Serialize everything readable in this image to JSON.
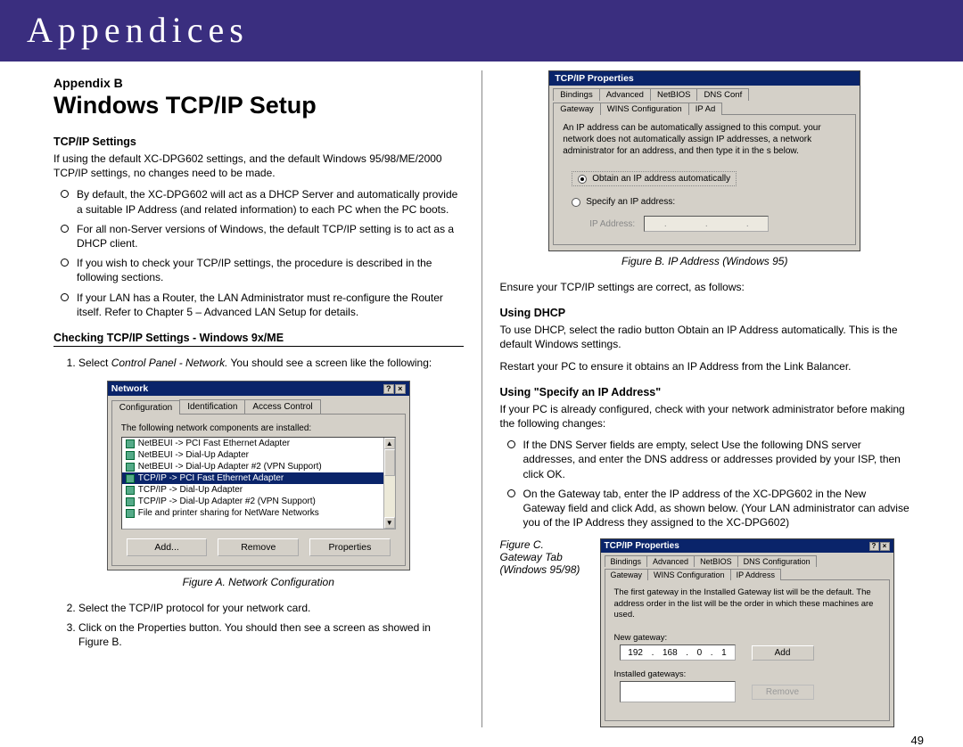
{
  "banner": "Appendices",
  "appendix_label": "Appendix B",
  "title": "Windows TCP/IP Setup",
  "left": {
    "s1_title": "TCP/IP Settings",
    "s1_intro": "If using the default XC-DPG602 settings, and the default Windows 95/98/ME/2000 TCP/IP settings, no changes need to be made.",
    "s1_bullets": [
      "By default, the XC-DPG602 will act as a DHCP Server and automatically provide a suitable IP Address (and related information) to each PC when the PC boots.",
      "For all non-Server versions of Windows, the default TCP/IP setting is to act as a DHCP client.",
      "If you wish to check your TCP/IP settings, the procedure is described in the following sections.",
      "If your LAN has a Router, the LAN Administrator must re-configure the Router itself. Refer to Chapter 5 – Advanced LAN Setup for details."
    ],
    "s2_title": "Checking TCP/IP Settings - Windows 9x/ME",
    "step1_pre": "Select ",
    "step1_em": "Control Panel - Network.",
    "step1_post": " You should see a screen like the following:",
    "figA": {
      "title": "Network",
      "tabs": [
        "Configuration",
        "Identification",
        "Access Control"
      ],
      "label": "The following network components are installed:",
      "rows": [
        "NetBEUI -> PCI Fast Ethernet Adapter",
        "NetBEUI -> Dial-Up Adapter",
        "NetBEUI -> Dial-Up Adapter #2 (VPN Support)",
        "TCP/IP -> PCI Fast Ethernet Adapter",
        "TCP/IP -> Dial-Up Adapter",
        "TCP/IP -> Dial-Up Adapter #2 (VPN Support)",
        "File and printer sharing for NetWare Networks"
      ],
      "selected_index": 3,
      "buttons": [
        "Add...",
        "Remove",
        "Properties"
      ]
    },
    "figA_caption": "Figure A. Network Configuration",
    "step2": "Select the TCP/IP protocol for your network card.",
    "step3": "Click on the Properties button. You should then see a screen as showed in Figure B."
  },
  "right": {
    "figB": {
      "title": "TCP/IP Properties",
      "tabs_row1": [
        "Bindings",
        "Advanced",
        "NetBIOS",
        "DNS Conf"
      ],
      "tabs_row2": [
        "Gateway",
        "WINS Configuration",
        "IP Ad"
      ],
      "desc": "An IP address can be automatically assigned to this comput. your network does not automatically assign IP addresses, a network administrator for an address, and then type it in the s below.",
      "radio1": "Obtain an IP address automatically",
      "radio2": "Specify an IP address:",
      "ip_label": "IP Address:"
    },
    "figB_caption": "Figure B. IP Address (Windows 95)",
    "ensure": "Ensure your TCP/IP settings are correct, as follows:",
    "dhcp_title": "Using DHCP",
    "dhcp_p1": "To use DHCP, select the radio button Obtain an IP Address automatically. This is the default Windows settings.",
    "dhcp_p2": "Restart your PC to ensure it obtains an IP Address from the Link Balancer.",
    "spec_title": "Using \"Specify an IP Address\"",
    "spec_intro": "If your PC is already configured, check with your network administrator before making the following changes:",
    "spec_bullets": [
      "If the DNS Server fields are empty, select Use the following DNS server addresses, and enter the DNS address or addresses provided by your ISP, then click OK.",
      "On the Gateway tab, enter the IP address of the XC-DPG602 in the New Gateway field and click Add, as shown below. (Your LAN administrator can advise you of the IP Address they assigned to the XC-DPG602)"
    ],
    "figC_side": "Figure C.\nGateway Tab\n(Windows 95/98)",
    "figC": {
      "title": "TCP/IP Properties",
      "tabs_row1": [
        "Bindings",
        "Advanced",
        "NetBIOS",
        "DNS Configuration"
      ],
      "tabs_row2": [
        "Gateway",
        "WINS Configuration",
        "IP Address"
      ],
      "desc": "The first gateway in the Installed Gateway list will be the default. The address order in the list will be the order in which these machines are used.",
      "new_label": "New gateway:",
      "ip_parts": [
        "192",
        "168",
        "0",
        "1"
      ],
      "add_btn": "Add",
      "installed_label": "Installed gateways:",
      "remove_btn": "Remove"
    }
  },
  "page_num": "49"
}
